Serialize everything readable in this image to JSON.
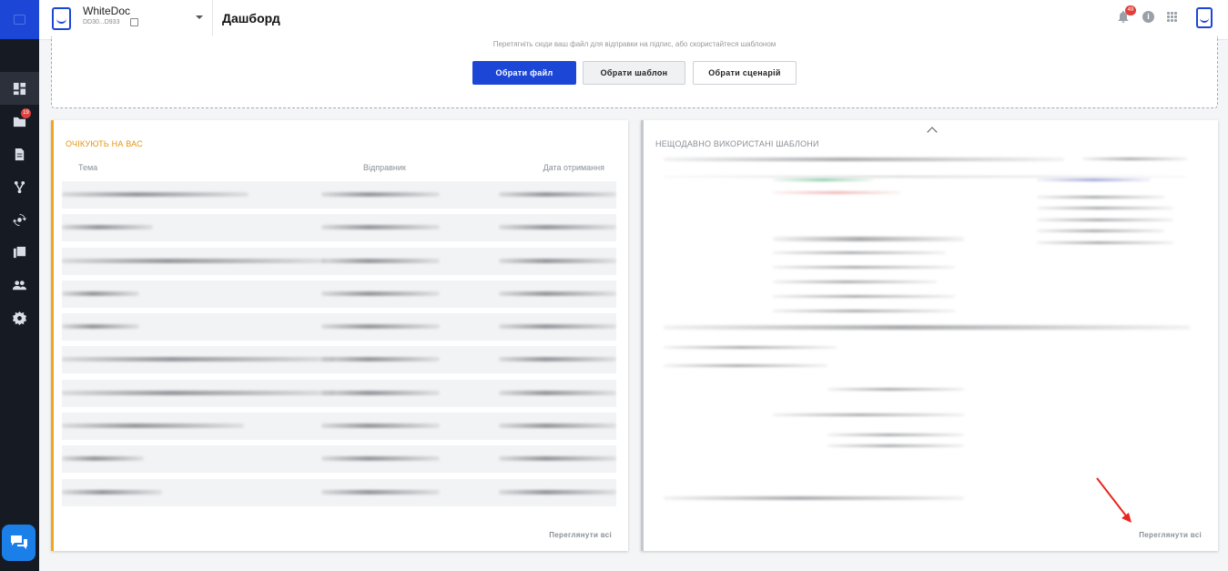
{
  "app": {
    "org_name": "WhiteDoc",
    "org_id": "DD30...D933",
    "page_title": "Дашборд"
  },
  "sidebar": {
    "folder_badge": "19",
    "items": [
      {
        "icon": "dashboard-icon",
        "active": true
      },
      {
        "icon": "folder-icon"
      },
      {
        "icon": "document-icon"
      },
      {
        "icon": "workflow-icon"
      },
      {
        "icon": "sync-icon"
      },
      {
        "icon": "library-icon"
      },
      {
        "icon": "users-icon"
      },
      {
        "icon": "settings-icon"
      }
    ]
  },
  "topbar": {
    "notification_count": "49",
    "info_glyph": "i"
  },
  "upload": {
    "hint": "Перетягніть сюди ваш файл для відправки на підпис, або скористайтеся шаблоном",
    "choose_file": "Обрати файл",
    "choose_template": "Обрати шаблон",
    "choose_scenario": "Обрати сценарій"
  },
  "awaiting": {
    "title": "ОЧІКУЮТЬ НА ВАС",
    "col_subject": "Тема",
    "col_sender": "Відправник",
    "col_date": "Дата отримання",
    "view_all": "Переглянути всі"
  },
  "templates": {
    "title": "НЕЩОДАВНО ВИКОРИСТАНІ ШАБЛОНИ",
    "view_all": "Переглянути всі"
  },
  "colors": {
    "brand": "#1c47d6",
    "sidebar_bg": "#161a22",
    "awaiting_accent": "#f0a71b",
    "badge": "#e0403d",
    "chat": "#1a7fe8",
    "annotation_arrow": "#e8261f"
  }
}
